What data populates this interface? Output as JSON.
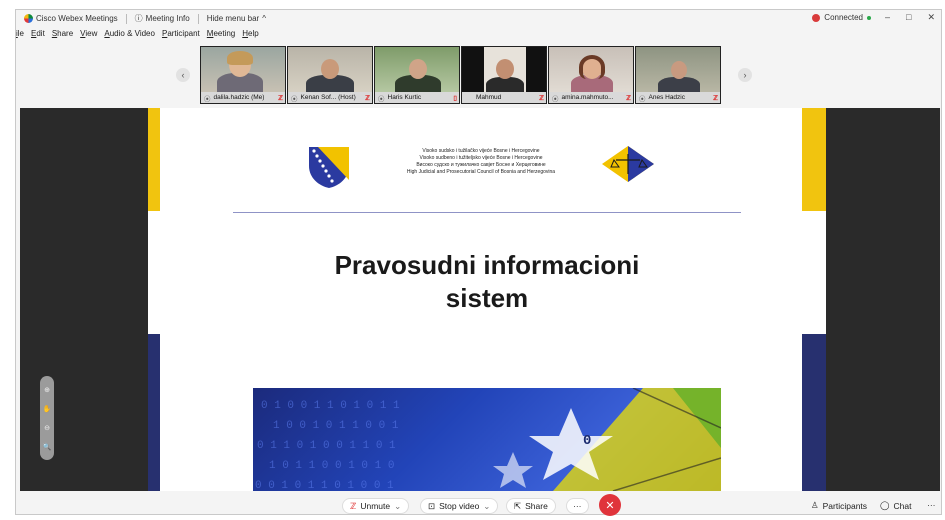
{
  "app": {
    "title": "Cisco Webex Meetings",
    "meeting_info": "Meeting Info",
    "hide_menu_bar": "Hide menu bar",
    "hide_menu_chevron": "^",
    "connection_status": "Connected",
    "window_controls": {
      "minimize": "–",
      "maximize": "□",
      "close": "✕"
    }
  },
  "menu": {
    "items": [
      "File",
      "Edit",
      "Share",
      "View",
      "Audio & Video",
      "Participant",
      "Meeting",
      "Help"
    ],
    "visible_labels": [
      "ile",
      "Edit",
      "Share",
      "View",
      "Audio & Video",
      "Participant",
      "Meeting",
      "Help"
    ]
  },
  "participants": [
    {
      "name": "dalila.hadzic (Me)"
    },
    {
      "name": "Kenan Sof... (Host)"
    },
    {
      "name": "Haris Kurtic"
    },
    {
      "name": "Mahmud"
    },
    {
      "name": "amina.mahmuto..."
    },
    {
      "name": "Anes Hadzic"
    }
  ],
  "strip_nav": {
    "prev": "‹",
    "next": "›"
  },
  "slide": {
    "header_lines": [
      "Visoko sudsko i tužilačko vijeće Bosne i Hercegovine",
      "Visoko sudbeno i tužiteljsko vijeće Bosne i Hercegovine",
      "Високо судско и тужилачко савјет Босне и Херцеговине",
      "High Judicial and Prosecutorial Council of Bosnia and Herzegovina"
    ],
    "title_line1": "Pravosudni informacioni",
    "title_line2": "sistem",
    "banner_glyph": "0"
  },
  "zoom_tools": [
    "⊕",
    "✋",
    "⊖",
    "🔍"
  ],
  "controls": {
    "unmute": "Unmute",
    "stop_video": "Stop video",
    "share": "Share",
    "more": "···",
    "end": "✕",
    "participants": "Participants",
    "chat": "Chat",
    "overflow": "···"
  },
  "colors": {
    "end_button": "#e0343b",
    "slide_yellow": "#f1c40f",
    "slide_navy": "#27306f",
    "connected_dot": "#2aa84a"
  }
}
